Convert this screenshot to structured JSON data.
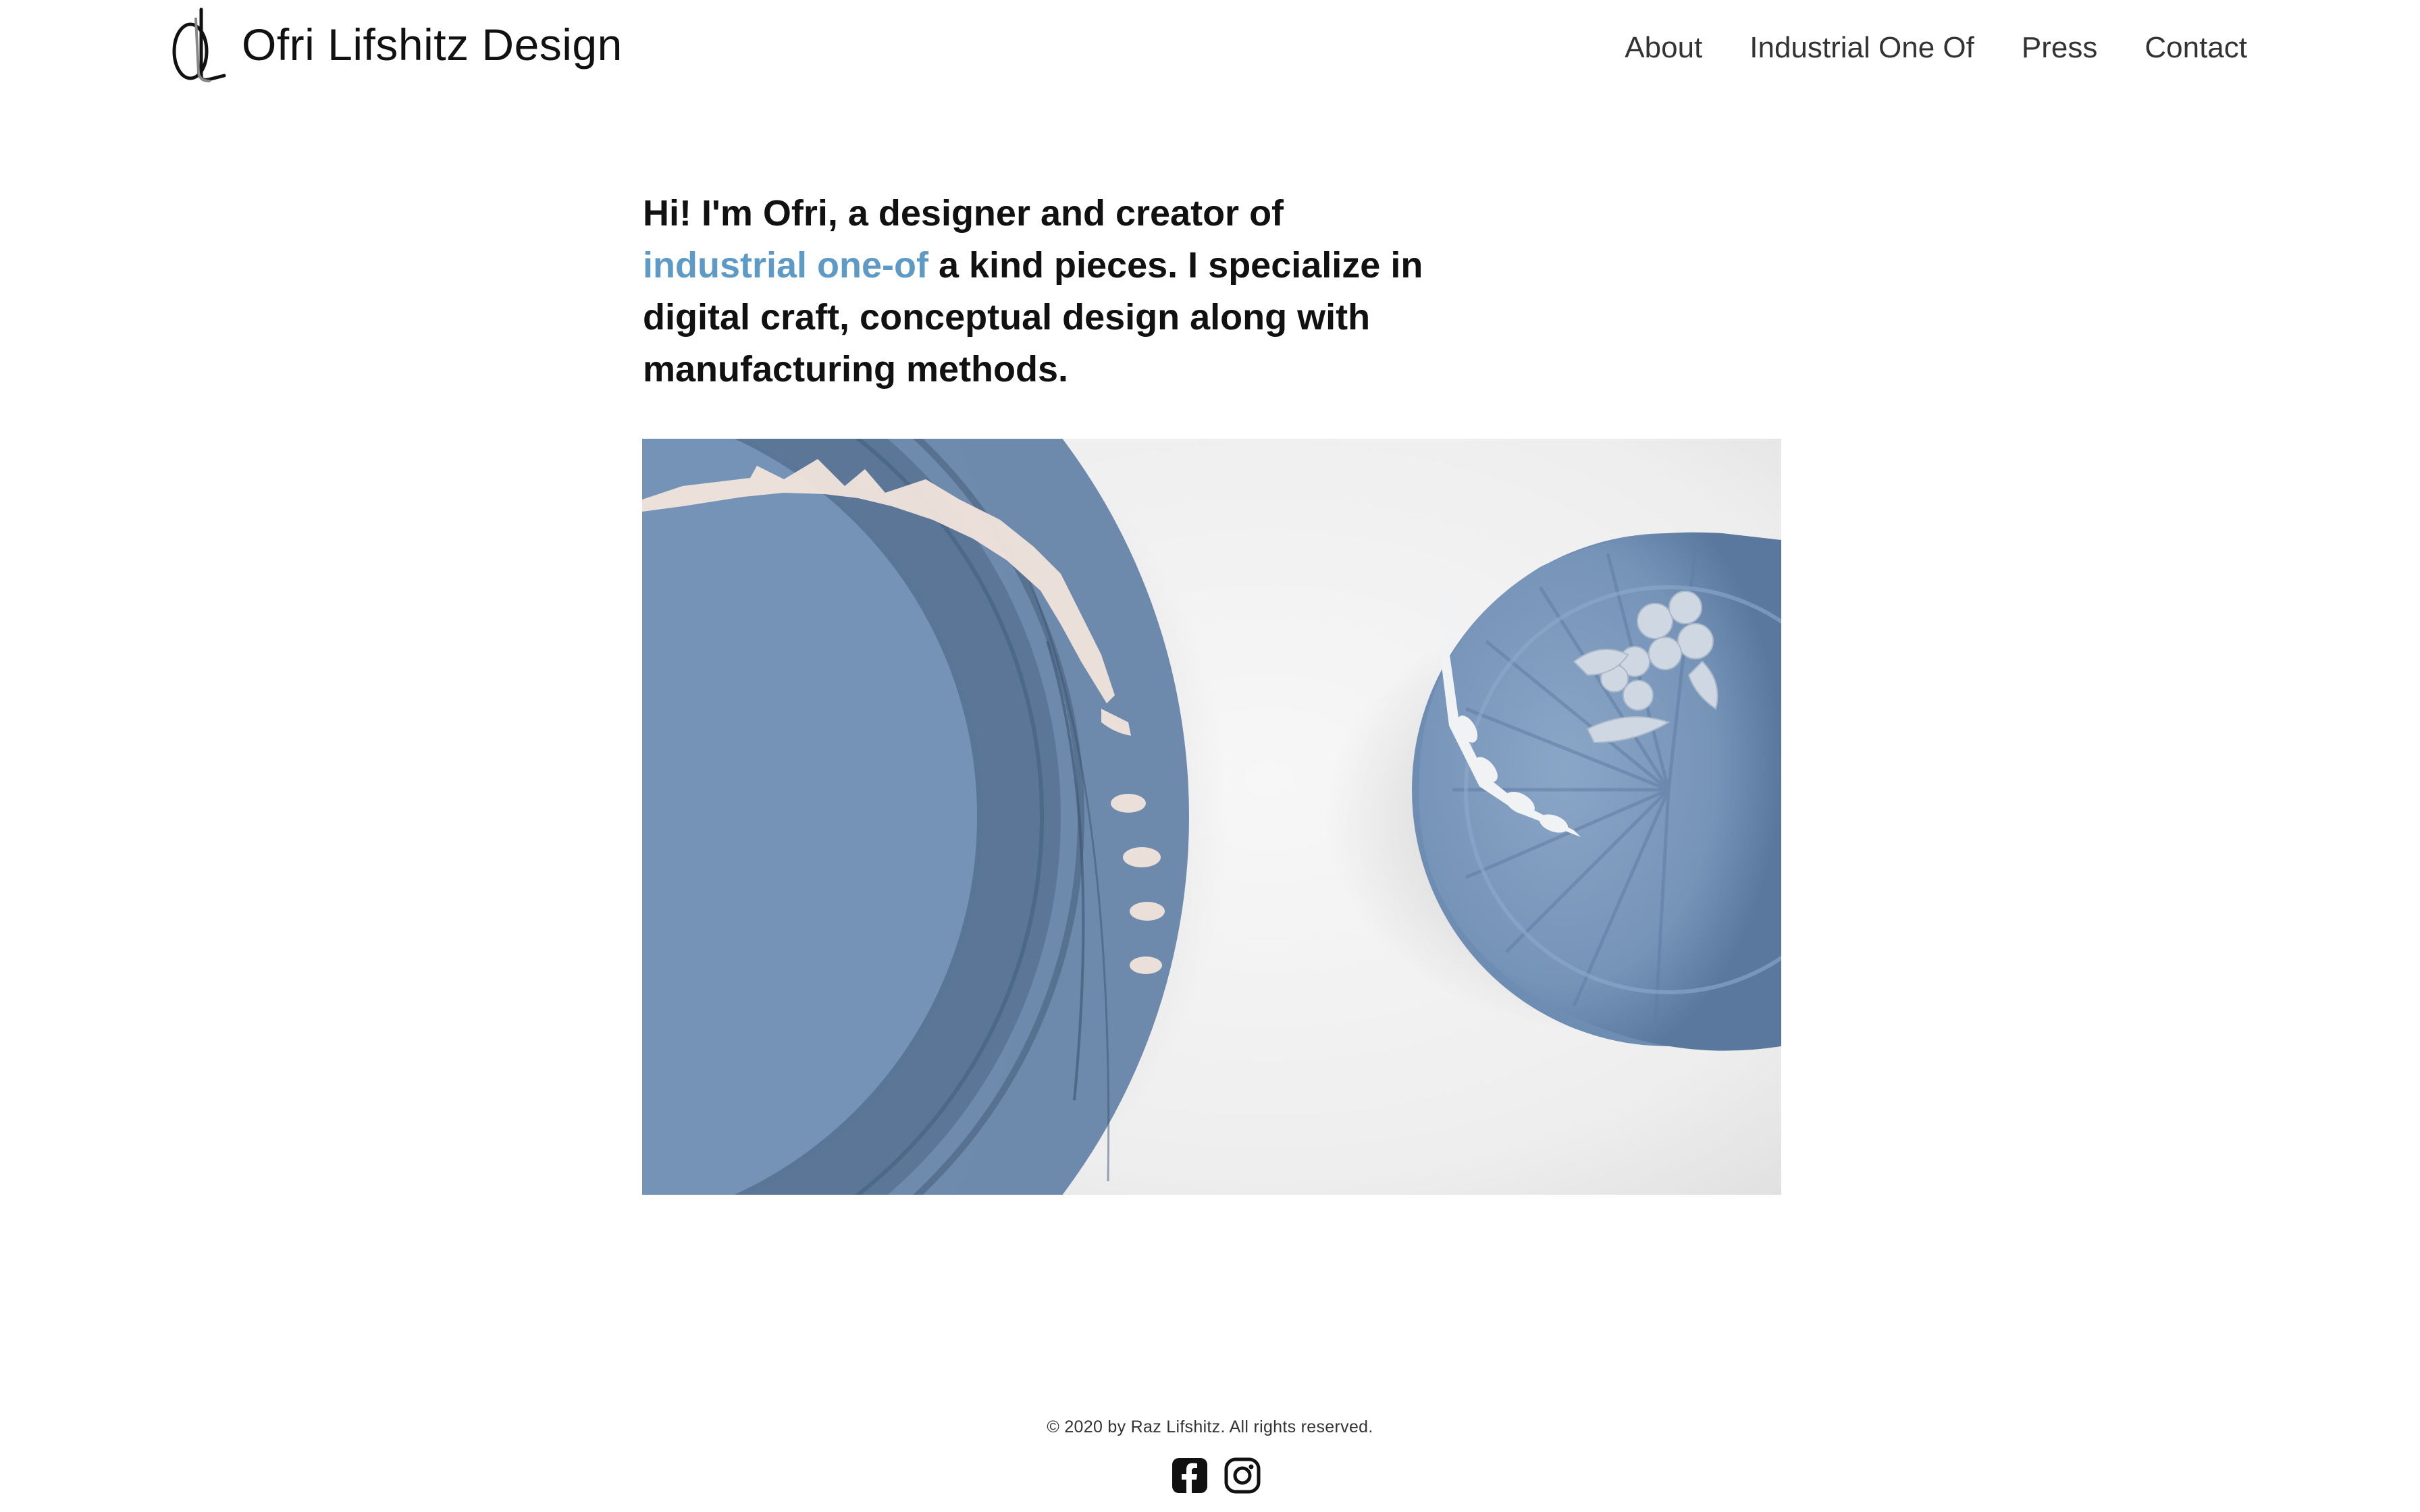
{
  "brand": {
    "name": "Ofri Lifshitz Design",
    "logo_icon": "ol-monogram-logo"
  },
  "nav": {
    "items": [
      {
        "label": "About"
      },
      {
        "label": "Industrial One Of"
      },
      {
        "label": "Press"
      },
      {
        "label": "Contact"
      }
    ]
  },
  "intro": {
    "text_before": "Hi! I'm Ofri, a designer and creator of ",
    "link_text": "industrial one-of",
    "text_after": " a kind pieces. I specialize in digital craft, conceptual design along with manufacturing methods.",
    "accent_color": "#5d9ac6"
  },
  "hero": {
    "subject": "blue ceramic plates",
    "colors": {
      "background": "#f1f1f1",
      "plate": "#7f9dbf",
      "plate_dark": "#4a6480",
      "relief": "#f0e2da"
    }
  },
  "footer": {
    "copyright": "© 2020 by Raz Lifshitz. All rights reserved.",
    "social": [
      {
        "icon": "facebook-icon"
      },
      {
        "icon": "instagram-icon"
      }
    ]
  }
}
